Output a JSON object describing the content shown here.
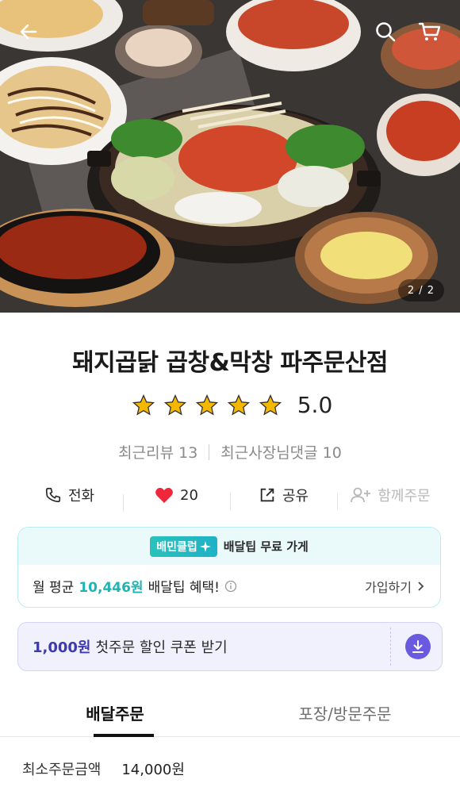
{
  "hero": {
    "page_counter": "2 / 2",
    "back_icon": "arrow-left-icon",
    "search_icon": "search-icon",
    "cart_icon": "cart-icon"
  },
  "store": {
    "name": "돼지곱닭 곱창&막창 파주문산점",
    "rating": "5.0",
    "stars": 5,
    "star_color": "#f5b800",
    "recent_reviews": "최근리뷰 13",
    "owner_replies": "최근사장님댓글 10"
  },
  "actions": {
    "call": "전화",
    "likes": "20",
    "share": "공유",
    "group_order": "함께주문"
  },
  "club": {
    "badge": "배민클럽",
    "headline": "배달팁 무료 가게",
    "prefix": "월 평균",
    "amount": "10,446원",
    "suffix": "배달팁 혜택!",
    "join": "가입하기",
    "accent": "#2ac1bc"
  },
  "coupon": {
    "amount": "1,000원",
    "text": "첫주문 할인 쿠폰 받기",
    "accent": "#6a5ae0"
  },
  "tabs": [
    {
      "label": "배달주문",
      "active": true
    },
    {
      "label": "포장/방문주문",
      "active": false
    }
  ],
  "min_order": {
    "label": "최소주문금액",
    "value": "14,000원"
  }
}
